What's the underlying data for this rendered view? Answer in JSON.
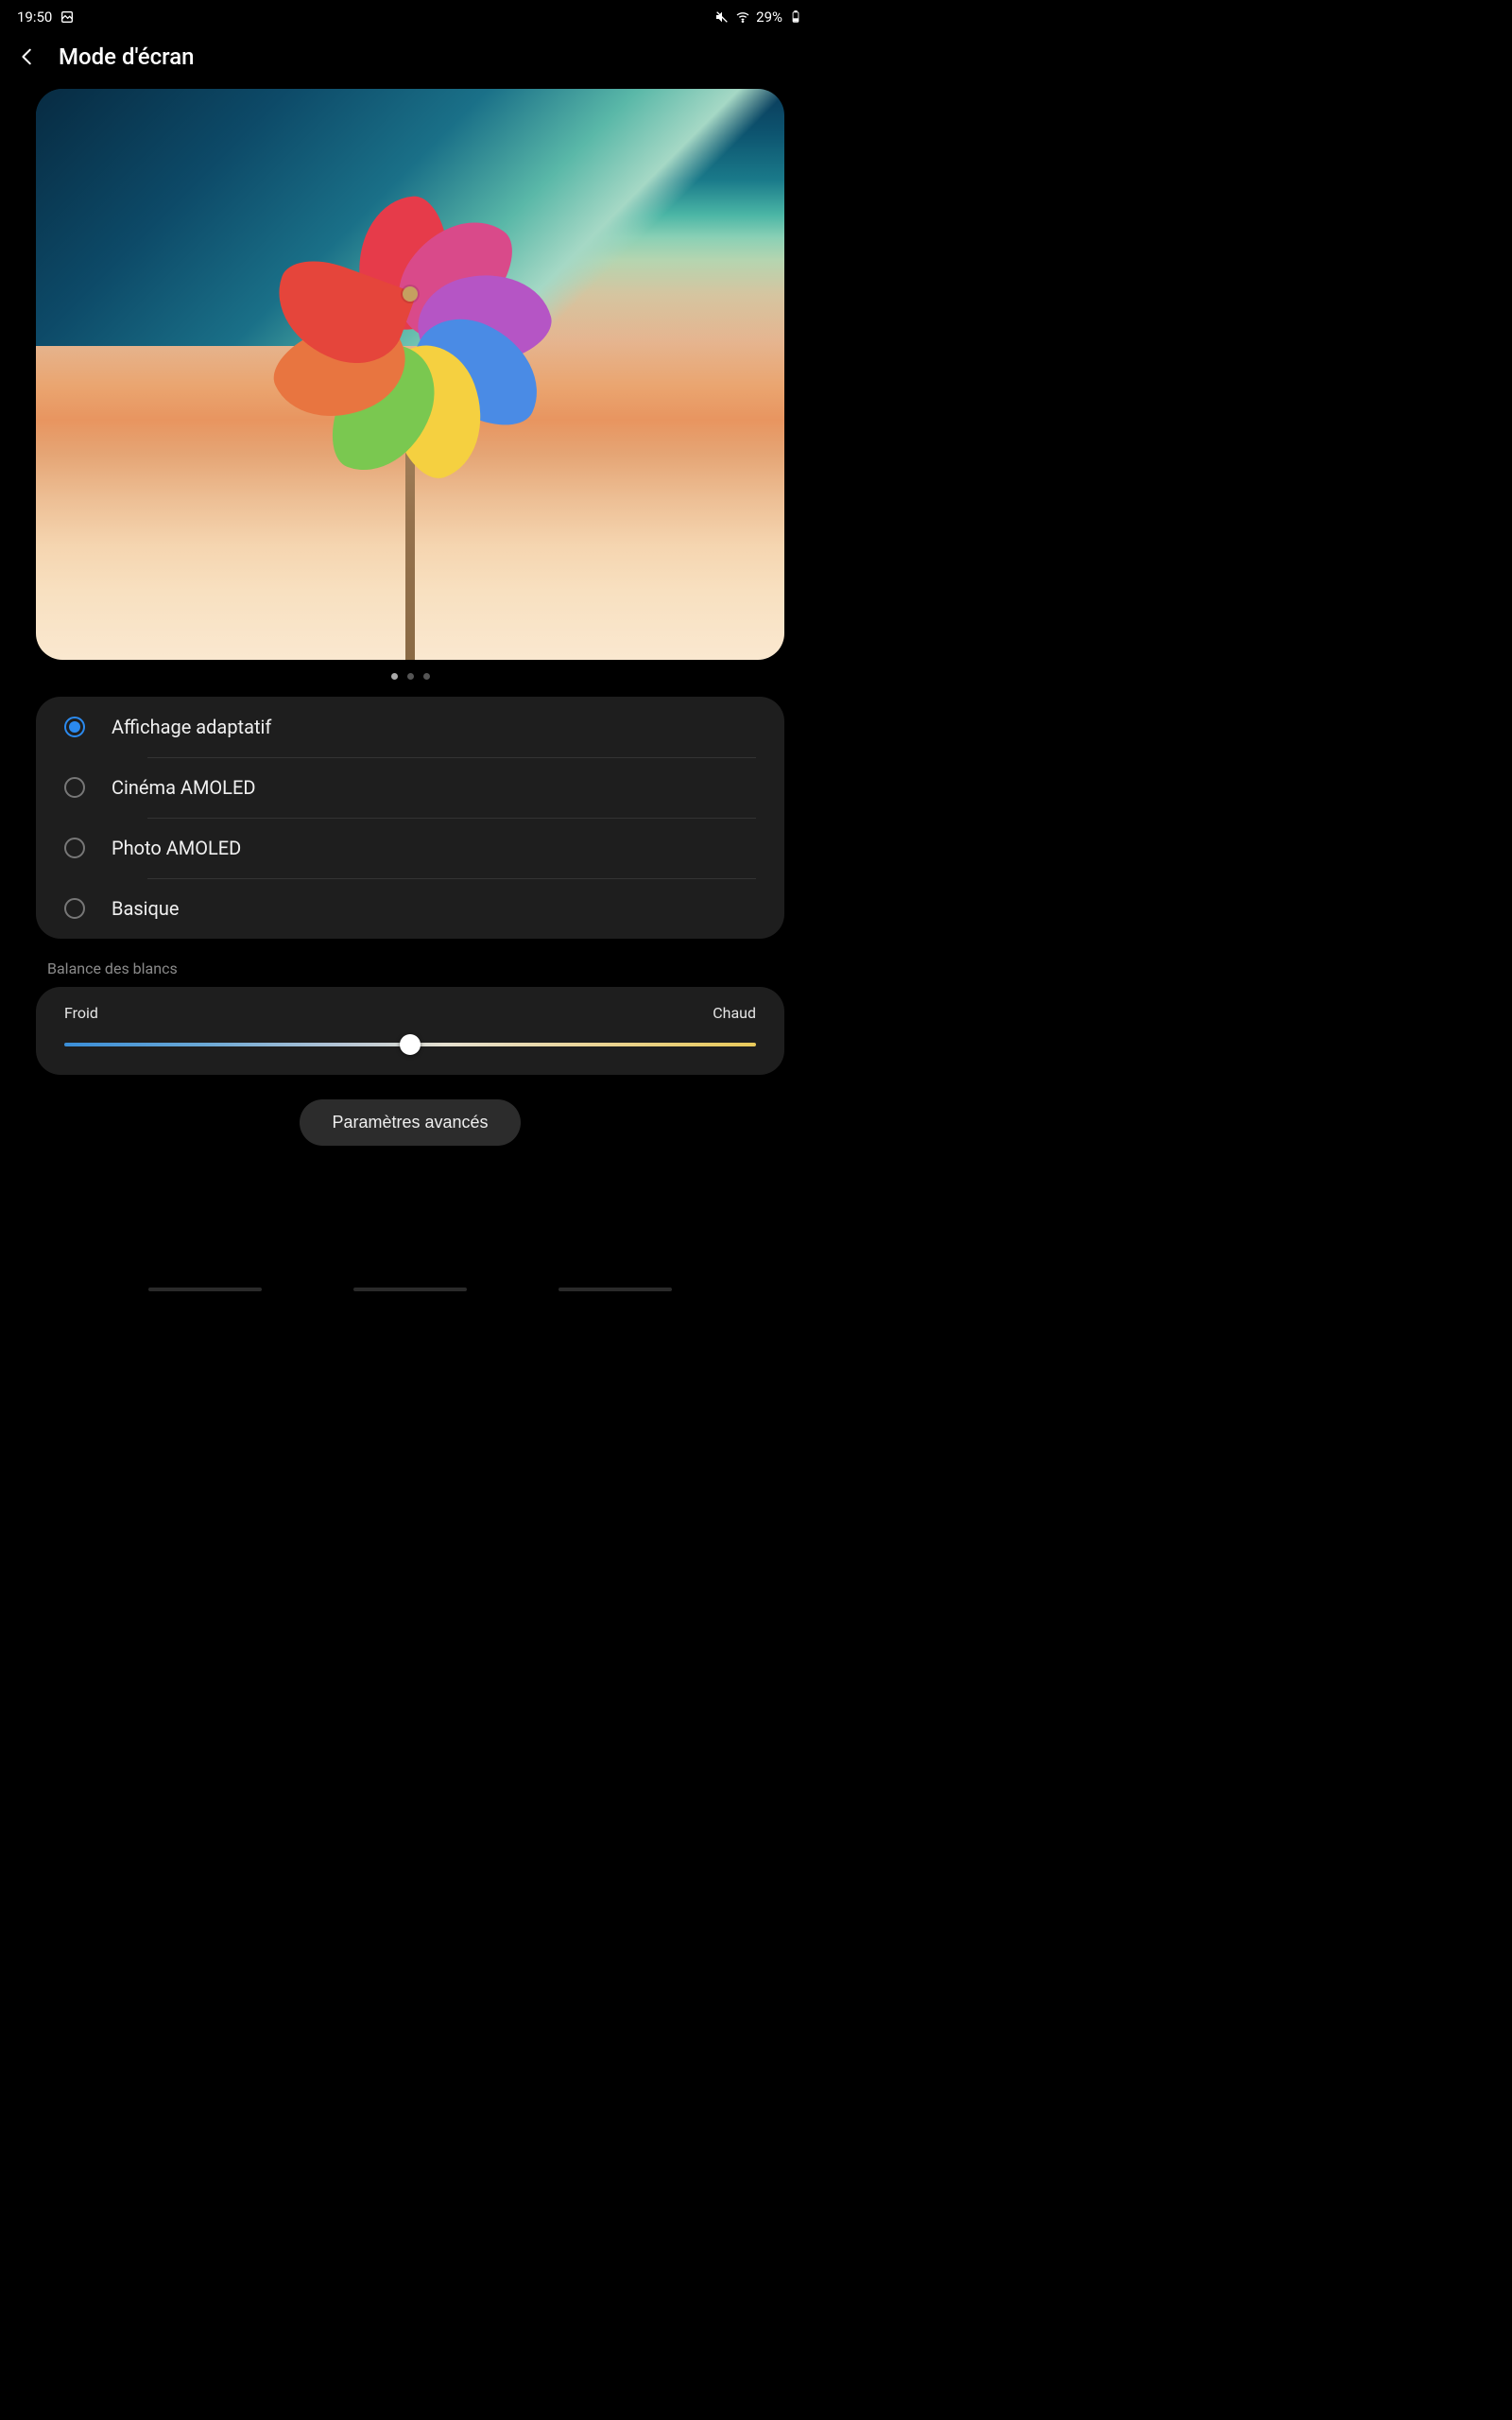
{
  "status_bar": {
    "time": "19:50",
    "battery_text": "29%",
    "icons": {
      "screenshot": "screenshot-icon",
      "mute": "mute-icon",
      "wifi": "wifi-icon",
      "battery": "battery-icon"
    }
  },
  "header": {
    "title": "Mode d'écran"
  },
  "pager": {
    "count": 3,
    "active_index": 0
  },
  "screen_modes": {
    "options": [
      {
        "id": "adaptive",
        "label": "Affichage adaptatif",
        "selected": true
      },
      {
        "id": "cinema",
        "label": "Cinéma AMOLED",
        "selected": false
      },
      {
        "id": "photo",
        "label": "Photo AMOLED",
        "selected": false
      },
      {
        "id": "basic",
        "label": "Basique",
        "selected": false
      }
    ]
  },
  "white_balance": {
    "section_label": "Balance des blancs",
    "min_label": "Froid",
    "max_label": "Chaud",
    "value_percent": 50
  },
  "advanced": {
    "button_label": "Paramètres avancés"
  },
  "colors": {
    "accent": "#2b8aef",
    "card_bg": "#1e1e1e"
  }
}
